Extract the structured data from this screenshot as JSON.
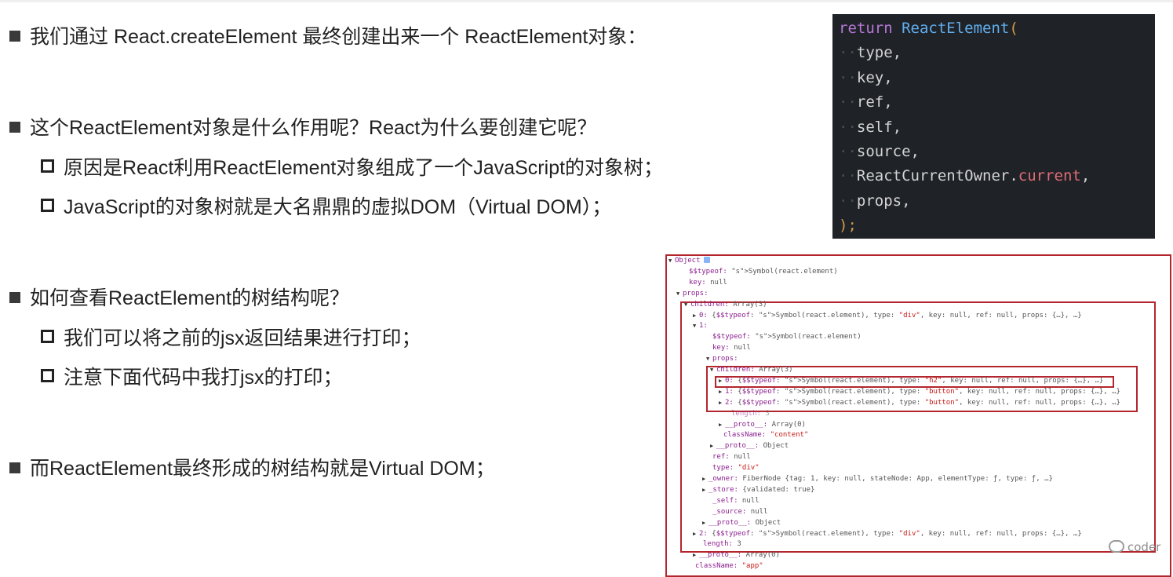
{
  "bullets": [
    {
      "level": 1,
      "text": "我们通过 React.createElement 最终创建出来一个 ReactElement对象："
    },
    {
      "level": 1,
      "text": "这个ReactElement对象是什么作用呢？React为什么要创建它呢？"
    },
    {
      "level": 2,
      "text": "原因是React利用ReactElement对象组成了一个JavaScript的对象树；"
    },
    {
      "level": 2,
      "text": "JavaScript的对象树就是大名鼎鼎的虚拟DOM（Virtual DOM）；"
    },
    {
      "level": 1,
      "text": "如何查看ReactElement的树结构呢？"
    },
    {
      "level": 2,
      "text": "我们可以将之前的jsx返回结果进行打印；"
    },
    {
      "level": 2,
      "text": "注意下面代码中我打jsx的打印；"
    },
    {
      "level": 1,
      "text": "而ReactElement最终形成的树结构就是Virtual DOM；"
    }
  ],
  "code": {
    "keyword": "return",
    "fn": "ReactElement",
    "open": "(",
    "args": [
      "type,",
      "key,",
      "ref,",
      "self,",
      "source,"
    ],
    "owner_obj": "ReactCurrentOwner.",
    "owner_prop": "current",
    "owner_tail": ",",
    "last_arg": "props,",
    "close": ");"
  },
  "console": {
    "lines": [
      {
        "tri": "▼",
        "k": "Object",
        "v": ""
      },
      {
        "tri": "",
        "k": "$$typeof:",
        "v": " Symbol(react.element)"
      },
      {
        "tri": "",
        "k": "key:",
        "v": " null"
      },
      {
        "tri": "▼",
        "k": "props:",
        "v": ""
      },
      {
        "tri": "▼",
        "k": "children:",
        "v": " Array(3)"
      },
      {
        "tri": "▶",
        "k": "0:",
        "v": " {$$typeof: Symbol(react.element), type: \"div\", key: null, ref: null, props: {…}, …}"
      },
      {
        "tri": "▼",
        "k": "1:",
        "v": ""
      },
      {
        "tri": "",
        "k": "$$typeof:",
        "v": " Symbol(react.element)"
      },
      {
        "tri": "",
        "k": "key:",
        "v": " null"
      },
      {
        "tri": "▼",
        "k": "props:",
        "v": ""
      },
      {
        "tri": "▼",
        "k": "children:",
        "v": " Array(3)"
      },
      {
        "tri": "▶",
        "k": "0:",
        "v": " {$$typeof: Symbol(react.element), type: \"h2\", key: null, ref: null, props: {…}, …}"
      },
      {
        "tri": "▶",
        "k": "1:",
        "v": " {$$typeof: Symbol(react.element), type: \"button\", key: null, ref: null, props: {…}, …}"
      },
      {
        "tri": "▶",
        "k": "2:",
        "v": " {$$typeof: Symbol(react.element), type: \"button\", key: null, ref: null, props: {…}, …}"
      },
      {
        "tri": "",
        "k": "length:",
        "v": " 3"
      },
      {
        "tri": "▶",
        "k": "__proto__:",
        "v": " Array(0)"
      },
      {
        "tri": "",
        "k": "className:",
        "v": " \"content\""
      },
      {
        "tri": "▶",
        "k": "__proto__:",
        "v": " Object"
      },
      {
        "tri": "",
        "k": "ref:",
        "v": " null"
      },
      {
        "tri": "",
        "k": "type:",
        "v": " \"div\""
      },
      {
        "tri": "▶",
        "k": "_owner:",
        "v": " FiberNode {tag: 1, key: null, stateNode: App, elementType: ƒ, type: ƒ, …}"
      },
      {
        "tri": "▶",
        "k": "_store:",
        "v": " {validated: true}"
      },
      {
        "tri": "",
        "k": "_self:",
        "v": " null"
      },
      {
        "tri": "",
        "k": "_source:",
        "v": " null"
      },
      {
        "tri": "▶",
        "k": "__proto__:",
        "v": " Object"
      },
      {
        "tri": "▶",
        "k": "2:",
        "v": " {$$typeof: Symbol(react.element), type: \"div\", key: null, ref: null, props: {…}, …}"
      },
      {
        "tri": "",
        "k": "length:",
        "v": " 3"
      },
      {
        "tri": "▶",
        "k": "__proto__:",
        "v": " Array(0)"
      },
      {
        "tri": "",
        "k": "className:",
        "v": " \"app\""
      }
    ]
  },
  "watermark": "coder"
}
